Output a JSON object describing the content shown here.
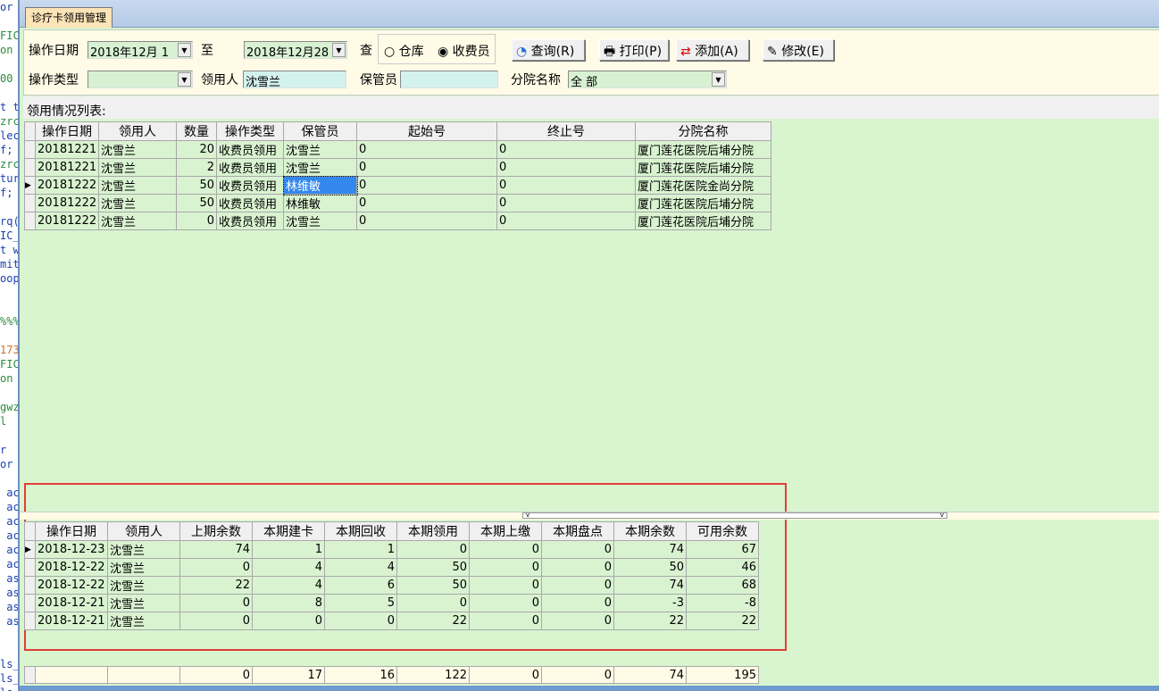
{
  "background_code_lines": [
    "or",
    "",
    "FIC",
    "on",
    "",
    "00",
    "",
    "t t",
    "zrc",
    "lec",
    "f;",
    "zrc",
    "tur",
    "f;",
    "",
    "rq(",
    "IC_",
    "t w",
    "mit",
    "oop",
    "",
    "",
    "%%%",
    "",
    "173",
    "FIC",
    "on",
    "",
    "gwz",
    "l",
    "",
    "r",
    "or",
    "",
    " ac",
    " ac",
    " ac",
    " ac",
    " ac",
    " ac",
    " as",
    " as",
    " as",
    " as",
    "",
    "",
    "ls_",
    "ls_",
    "ls_"
  ],
  "tab": {
    "label": "诊疗卡领用管理"
  },
  "form": {
    "date_label": "操作日期",
    "date_from": "2018年12月 1",
    "to_label": "至",
    "date_to": "2018年12月28",
    "query_label": "查",
    "radio_warehouse": "仓库",
    "radio_cashier": "收费员",
    "radio_selected": "收费员",
    "op_type_label": "操作类型",
    "op_type_value": "",
    "receiver_label": "领用人",
    "receiver_value": "沈雪兰",
    "keeper_label": "保管员",
    "keeper_value": "",
    "branch_label": "分院名称",
    "branch_value": "全 部"
  },
  "buttons": {
    "query": "查询(R)",
    "print": "打印(P)",
    "add": "添加(A)",
    "edit": "修改(E)"
  },
  "list_label": "领用情况列表:",
  "grid1": {
    "columns": [
      "操作日期",
      "领用人",
      "数量",
      "操作类型",
      "保管员",
      "起始号",
      "终止号",
      "分院名称"
    ],
    "rows": [
      [
        "20181221",
        "沈雪兰",
        "20",
        "收费员领用",
        "沈雪兰",
        "0",
        "0",
        "厦门莲花医院后埔分院"
      ],
      [
        "20181221",
        "沈雪兰",
        "2",
        "收费员领用",
        "沈雪兰",
        "0",
        "0",
        "厦门莲花医院后埔分院"
      ],
      [
        "20181222",
        "沈雪兰",
        "50",
        "收费员领用",
        "林维敏",
        "0",
        "0",
        "厦门莲花医院金尚分院"
      ],
      [
        "20181222",
        "沈雪兰",
        "50",
        "收费员领用",
        "林维敏",
        "0",
        "0",
        "厦门莲花医院后埔分院"
      ],
      [
        "20181222",
        "沈雪兰",
        "0",
        "收费员领用",
        "沈雪兰",
        "0",
        "0",
        "厦门莲花医院后埔分院"
      ]
    ],
    "current_row": 2
  },
  "grid2": {
    "columns": [
      "操作日期",
      "领用人",
      "上期余数",
      "本期建卡",
      "本期回收",
      "本期领用",
      "本期上缴",
      "本期盘点",
      "本期余数",
      "可用余数"
    ],
    "rows": [
      [
        "2018-12-23",
        "沈雪兰",
        "74",
        "1",
        "1",
        "0",
        "0",
        "0",
        "74",
        "67"
      ],
      [
        "2018-12-22",
        "沈雪兰",
        "0",
        "4",
        "4",
        "50",
        "0",
        "0",
        "50",
        "46"
      ],
      [
        "2018-12-22",
        "沈雪兰",
        "22",
        "4",
        "6",
        "50",
        "0",
        "0",
        "74",
        "68"
      ],
      [
        "2018-12-21",
        "沈雪兰",
        "0",
        "8",
        "5",
        "0",
        "0",
        "0",
        "-3",
        "-8"
      ],
      [
        "2018-12-21",
        "沈雪兰",
        "0",
        "0",
        "0",
        "22",
        "0",
        "0",
        "22",
        "22"
      ]
    ],
    "current_row": 0
  },
  "totals": [
    "",
    "",
    "0",
    "17",
    "16",
    "122",
    "0",
    "0",
    "74",
    "195"
  ],
  "colors": {
    "grid_bg": "#d9f3d1",
    "form_bg": "#fffbe6",
    "highlight": "#e53b35",
    "selection": "#3388ee"
  }
}
